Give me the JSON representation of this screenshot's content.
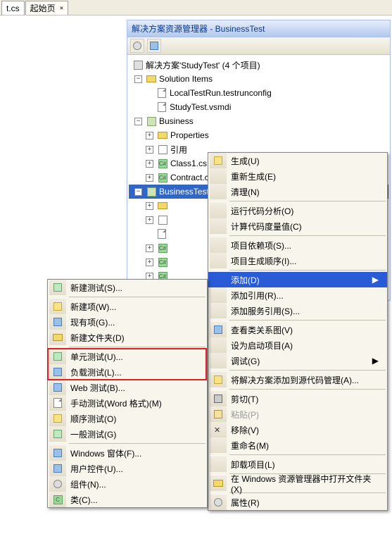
{
  "tabs": {
    "file_cs": "t.cs",
    "start_page": "起始页"
  },
  "panel": {
    "title": "解决方案资源管理器 - BusinessTest"
  },
  "tree": {
    "solution": "解决方案'StudyTest' (4 个项目)",
    "solution_items": "Solution Items",
    "localtest": "LocalTestRun.testrunconfig",
    "studytest": "StudyTest.vsmdi",
    "business": "Business",
    "properties": "Properties",
    "references": "引用",
    "class1": "Class1.cs",
    "contract": "Contract.cs",
    "businesstest": "BusinessTest"
  },
  "main_menu": {
    "build": "生成(U)",
    "rebuild": "重新生成(E)",
    "clean": "清理(N)",
    "code_analysis": "运行代码分析(O)",
    "calc_metrics": "计算代码度量值(C)",
    "proj_deps": "项目依赖项(S)...",
    "build_order": "项目生成顺序(I)...",
    "add": "添加(D)",
    "add_ref": "添加引用(R)...",
    "add_svc_ref": "添加服务引用(S)...",
    "class_diagram": "查看类关系图(V)",
    "set_startup": "设为启动项目(A)",
    "debug": "调试(G)",
    "add_to_scc": "将解决方案添加到源代码管理(A)...",
    "cut": "剪切(T)",
    "paste": "粘贴(P)",
    "remove": "移除(V)",
    "rename": "重命名(M)",
    "unload": "卸载项目(L)",
    "open_in_explorer": "在 Windows 资源管理器中打开文件夹(X)",
    "properties": "属性(R)"
  },
  "sub_menu": {
    "new_test": "新建测试(S)...",
    "new_item": "新建项(W)...",
    "existing_item": "现有项(G)...",
    "new_folder": "新建文件夹(D)",
    "unit_test": "单元测试(U)...",
    "load_test": "负载测试(L)...",
    "web_test": "Web 测试(B)...",
    "manual_test": "手动测试(Word 格式)(M)",
    "ordered_test": "顺序测试(O)",
    "generic_test": "一般测试(G)",
    "windows_form": "Windows 窗体(F)...",
    "user_control": "用户控件(U)...",
    "component": "组件(N)...",
    "class": "类(C)..."
  },
  "glyph": {
    "arrow_right": "▶",
    "minus": "−",
    "plus": "+",
    "x": "✕"
  }
}
